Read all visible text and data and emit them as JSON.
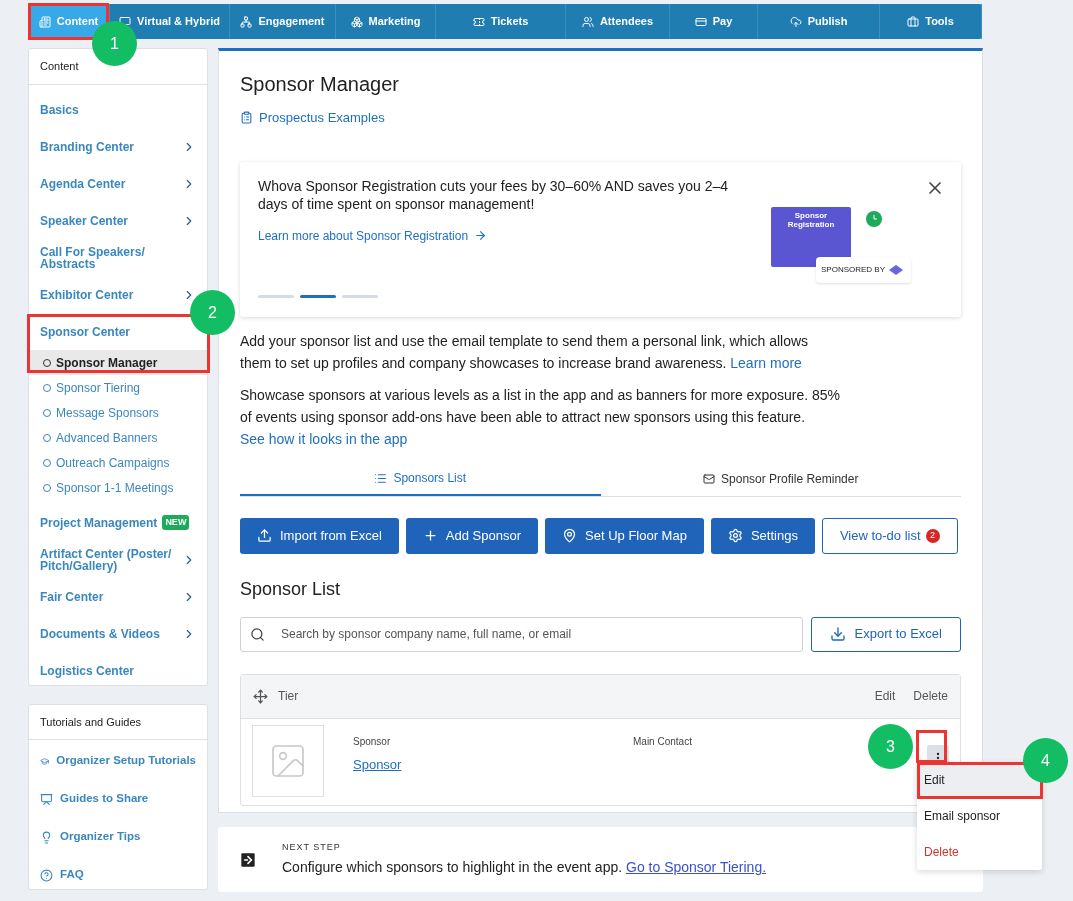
{
  "nav": [
    {
      "label": "Content",
      "selected": true
    },
    {
      "label": "Virtual & Hybrid",
      "selected": false
    },
    {
      "label": "Engagement",
      "selected": false
    },
    {
      "label": "Marketing",
      "selected": false
    },
    {
      "label": "Tickets",
      "selected": false
    },
    {
      "label": "Attendees",
      "selected": false
    },
    {
      "label": "Pay",
      "selected": false
    },
    {
      "label": "Publish",
      "selected": false
    },
    {
      "label": "Tools",
      "selected": false
    }
  ],
  "sidebar": {
    "title": "Content",
    "items": [
      {
        "label": "Basics",
        "chevron": false
      },
      {
        "label": "Branding Center",
        "chevron": true
      },
      {
        "label": "Agenda Center",
        "chevron": true
      },
      {
        "label": "Speaker Center",
        "chevron": true
      },
      {
        "label": "Call For Speakers/ Abstracts",
        "chevron": false
      },
      {
        "label": "Exhibitor Center",
        "chevron": true
      },
      {
        "label": "Sponsor Center",
        "chevron": false,
        "children": [
          {
            "label": "Sponsor Manager",
            "selected": true
          },
          {
            "label": "Sponsor Tiering",
            "selected": false
          },
          {
            "label": "Message Sponsors",
            "selected": false
          },
          {
            "label": "Advanced Banners",
            "selected": false
          },
          {
            "label": "Outreach Campaigns",
            "selected": false
          },
          {
            "label": "Sponsor 1-1 Meetings",
            "selected": false
          }
        ]
      },
      {
        "label": "Project Management",
        "chevron": false,
        "badge": "NEW"
      },
      {
        "label": "Artifact Center (Poster/ Pitch/Gallery)",
        "chevron": true
      },
      {
        "label": "Fair Center",
        "chevron": true
      },
      {
        "label": "Documents & Videos",
        "chevron": true
      },
      {
        "label": "Logistics Center",
        "chevron": false
      }
    ]
  },
  "guides": {
    "title": "Tutorials and Guides",
    "items": [
      "Organizer Setup Tutorials",
      "Guides to Share",
      "Organizer Tips",
      "FAQ"
    ]
  },
  "page": {
    "title": "Sponsor Manager",
    "link": "Prospectus Examples"
  },
  "banner": {
    "text": "Whova Sponsor Registration cuts your fees by 30–60% AND saves you 2–4 days of time spent on sponsor management!",
    "link": "Learn more about Sponsor Registration",
    "card_title": "Sponsor Registration",
    "card_caption": "SPONSORED BY",
    "dots": [
      {
        "selected": false
      },
      {
        "selected": true
      },
      {
        "selected": false
      }
    ]
  },
  "paragraphs": [
    {
      "text": "Add your sponsor list and use the email template to send them a personal link, which allows them to set up profiles and company showcases to increase brand awareness.",
      "link": "Learn more"
    },
    {
      "text": "Showcase sponsors at various levels as a list in the app and as banners for more exposure. 85% of events using sponsor add-ons have been able to attract new sponsors using this feature.",
      "link": "See how it looks in the app"
    }
  ],
  "tabs": [
    {
      "label": "Sponsors List",
      "selected": true
    },
    {
      "label": "Sponsor Profile Reminder",
      "selected": false
    }
  ],
  "actions": [
    {
      "label": "Import from Excel",
      "kind": "primary"
    },
    {
      "label": "Add Sponsor",
      "kind": "primary"
    },
    {
      "label": "Set Up Floor Map",
      "kind": "primary"
    },
    {
      "label": "Settings",
      "kind": "primary"
    },
    {
      "label": "View to-do list",
      "kind": "outline",
      "count": "2"
    }
  ],
  "list": {
    "title": "Sponsor List",
    "search_placeholder": "Search by sponsor company name, full name, or email",
    "export": "Export to Excel",
    "header": {
      "tier": "Tier",
      "edit": "Edit",
      "delete": "Delete"
    },
    "rows": [
      {
        "sponsor_label": "Sponsor",
        "sponsor": "Sponsor",
        "contact_label": "Main Contact"
      }
    ]
  },
  "menu": [
    {
      "label": "Edit",
      "kind": "normal",
      "selected": true
    },
    {
      "label": "Email sponsor",
      "kind": "normal",
      "selected": false
    },
    {
      "label": "Delete",
      "kind": "danger",
      "selected": false
    }
  ],
  "next_step": {
    "label": "NEXT STEP",
    "text": "Configure which sponsors to highlight in the event app.",
    "link": "Go to Sponsor Tiering."
  },
  "callouts": [
    "1",
    "2",
    "3",
    "4"
  ]
}
